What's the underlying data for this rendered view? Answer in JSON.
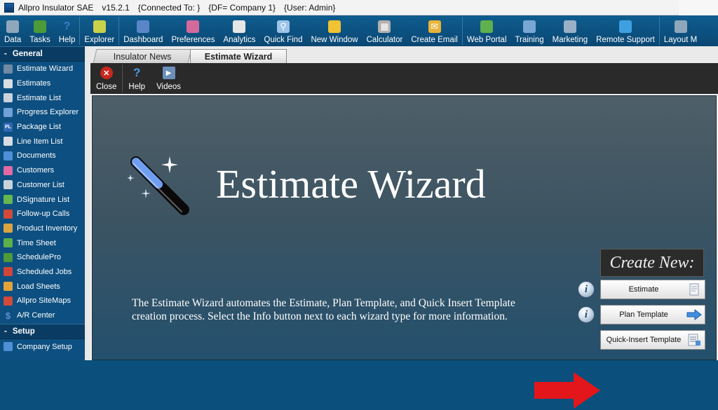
{
  "titlebar": {
    "app": "Allpro Insulator SAE",
    "version": "v15.2.1",
    "connected": "{Connected To: }",
    "df": "{DF= Company 1}",
    "user": "{User: Admin}"
  },
  "ribbon": {
    "items": [
      {
        "label": "Data",
        "icon": "database-icon",
        "color": "#8fa7bb"
      },
      {
        "label": "Tasks",
        "icon": "tasks-icon",
        "color": "#4c9a3a"
      },
      {
        "label": "Help",
        "icon": "help-icon",
        "color": "#3d7fc0"
      },
      {
        "label": "Explorer",
        "icon": "explorer-icon",
        "color": "#c9d24a"
      },
      {
        "label": "Dashboard",
        "icon": "dashboard-icon",
        "color": "#5a86c8"
      },
      {
        "label": "Preferences",
        "icon": "preferences-icon",
        "color": "#d46a9c"
      },
      {
        "label": "Analytics",
        "icon": "analytics-icon",
        "color": "#e6e6e6"
      },
      {
        "label": "Quick Find",
        "icon": "search-icon",
        "color": "#9cc3e8"
      },
      {
        "label": "New Window",
        "icon": "new-window-icon",
        "color": "#f1c232"
      },
      {
        "label": "Calculator",
        "icon": "calculator-icon",
        "color": "#b0b0b0"
      },
      {
        "label": "Create Email",
        "icon": "email-icon",
        "color": "#e8b339"
      },
      {
        "label": "Web Portal",
        "icon": "web-portal-icon",
        "color": "#5fb04f"
      },
      {
        "label": "Training",
        "icon": "training-icon",
        "color": "#7aa6d6"
      },
      {
        "label": "Marketing",
        "icon": "marketing-icon",
        "color": "#9ab0c8"
      },
      {
        "label": "Remote Support",
        "icon": "remote-support-icon",
        "color": "#3fa0e0"
      },
      {
        "label": "Layout M",
        "icon": "layout-icon",
        "color": "#8fa7bb"
      }
    ]
  },
  "nav": {
    "general_label": "General",
    "setup_label": "Setup",
    "items": [
      {
        "label": "Estimate Wizard",
        "icon": "wand-icon",
        "color": "#6f8aa3"
      },
      {
        "label": "Estimates",
        "icon": "estimates-icon",
        "color": "#d8dde3"
      },
      {
        "label": "Estimate List",
        "icon": "estimate-list-icon",
        "color": "#c9d2db"
      },
      {
        "label": "Progress Explorer",
        "icon": "progress-explorer-icon",
        "color": "#6fa0d8"
      },
      {
        "label": "Package List",
        "icon": "package-list-icon",
        "color": "#2f68b3"
      },
      {
        "label": "Line Item List",
        "icon": "line-item-icon",
        "color": "#d8dde3"
      },
      {
        "label": "Documents",
        "icon": "documents-icon",
        "color": "#4f8fd6"
      },
      {
        "label": "Customers",
        "icon": "customers-icon",
        "color": "#e06aa4"
      },
      {
        "label": "Customer List",
        "icon": "customer-list-icon",
        "color": "#c9d2db"
      },
      {
        "label": "DSignature List",
        "icon": "signature-icon",
        "color": "#64b84f"
      },
      {
        "label": "Follow-up Calls",
        "icon": "phone-icon",
        "color": "#d24a3a"
      },
      {
        "label": "Product Inventory",
        "icon": "inventory-icon",
        "color": "#d9a441"
      },
      {
        "label": "Time Sheet",
        "icon": "clock-icon",
        "color": "#5bb04a"
      },
      {
        "label": "SchedulePro",
        "icon": "schedule-icon",
        "color": "#4c9a3a"
      },
      {
        "label": "Scheduled Jobs",
        "icon": "calendar-icon",
        "color": "#d2453a"
      },
      {
        "label": "Load Sheets",
        "icon": "load-sheets-icon",
        "color": "#e3a23a"
      },
      {
        "label": "Allpro SiteMaps",
        "icon": "sitemaps-icon",
        "color": "#d24a3a"
      },
      {
        "label": "A/R Center",
        "icon": "dollar-icon",
        "color": "#5f8fd6"
      }
    ],
    "setup_items": [
      {
        "label": "Company Setup",
        "icon": "company-setup-icon",
        "color": "#4f8fd6"
      }
    ]
  },
  "tabs": {
    "news": "Insulator News",
    "wizard": "Estimate Wizard"
  },
  "toolbar": {
    "close": "Close",
    "help": "Help",
    "videos": "Videos"
  },
  "wizard": {
    "title": "Estimate Wizard",
    "description": "The Estimate Wizard automates the Estimate, Plan Template, and Quick Insert Template creation process.  Select the Info button next to each wizard type for more information.",
    "create_new": "Create New:",
    "info_glyph": "i",
    "buttons": [
      {
        "label": "Estimate",
        "icon": "estimate-doc-icon"
      },
      {
        "label": "Plan Template",
        "icon": "arrow-right-icon"
      },
      {
        "label": "Quick-Insert Template",
        "icon": "list-doc-icon"
      }
    ]
  }
}
